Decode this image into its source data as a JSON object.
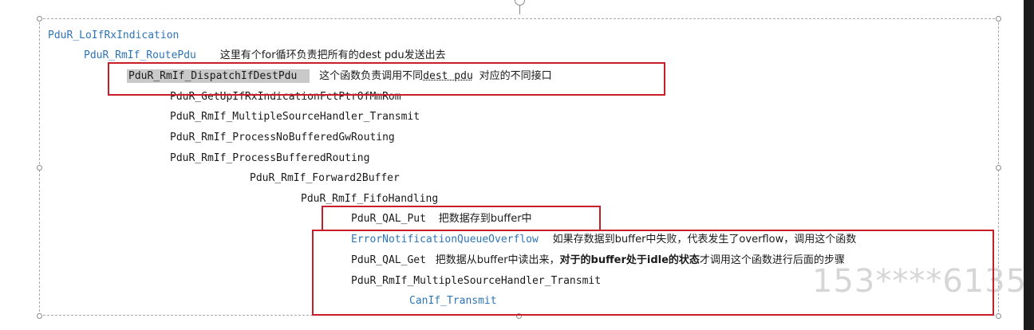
{
  "lines": {
    "l1": {
      "fn": "PduR_LoIfRxIndication"
    },
    "l2": {
      "fn": "PduR_RmIf_RoutePdu",
      "comment": "这里有个for循环负责把所有的dest pdu发送出去"
    },
    "l3": {
      "fn": "PduR_RmIf_DispatchIfDestPdu",
      "comment_a": "这个函数负责调用不同",
      "comment_code": "dest pdu",
      "comment_b": "对应的不同接口"
    },
    "l4": {
      "fn": "PduR_GetUpIfRxIndicationFctPtrOfMmRom"
    },
    "l5": {
      "fn": "PduR_RmIf_MultipleSourceHandler_Transmit"
    },
    "l6": {
      "fn": "PduR_RmIf_ProcessNoBufferedGwRouting"
    },
    "l7": {
      "fn": "PduR_RmIf_ProcessBufferedRouting"
    },
    "l8": {
      "fn": "PduR_RmIf_Forward2Buffer"
    },
    "l9": {
      "fn": "PduR_RmIf_FifoHandling"
    },
    "l10": {
      "fn": "PduR_QAL_Put",
      "comment": "把数据存到buffer中"
    },
    "l11": {
      "fn": "ErrorNotificationQueueOverflow",
      "comment": "如果存数据到buffer中失败，代表发生了overflow，调用这个函数"
    },
    "l12": {
      "fn": "PduR_QAL_Get",
      "comment_a": "把数据从buffer中读出来，",
      "comment_bold": "对于的buffer处于idle的状态",
      "comment_b": "才调用这个函数进行后面的步骤"
    },
    "l13": {
      "fn": "PduR_RmIf_MultipleSourceHandler_Transmit"
    },
    "l14": {
      "fn": "CanIf_Transmit"
    }
  },
  "watermark": "153****6135",
  "colors": {
    "link_blue": "#2e75b6",
    "highlight_red": "#c91d2a",
    "selection_gray": "#c9c9c9"
  }
}
